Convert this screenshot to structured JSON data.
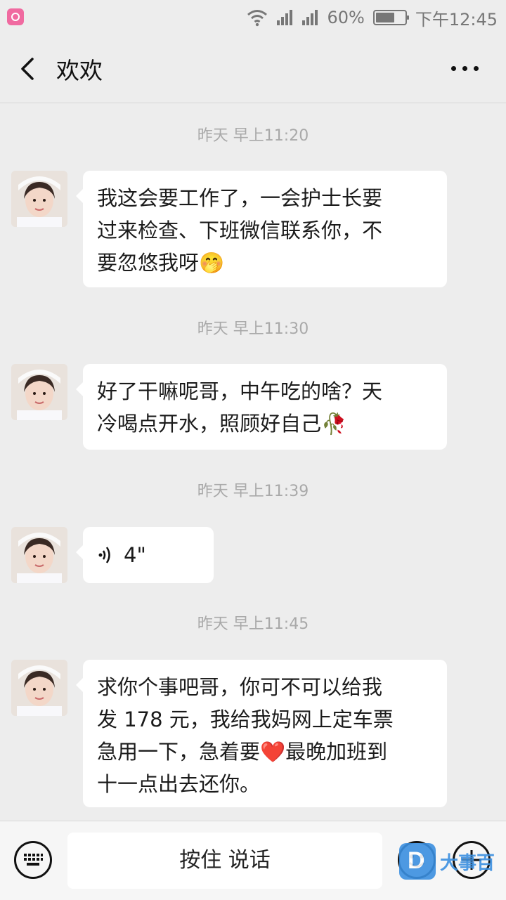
{
  "status_bar": {
    "battery_percent": "60%",
    "time": "下午12:45"
  },
  "header": {
    "title": "欢欢"
  },
  "messages": [
    {
      "timestamp": "昨天 早上11:20",
      "type": "text",
      "text": "我这会要工作了，一会护士长要\n过来检查、下班微信联系你，不\n要忽悠我呀🤭"
    },
    {
      "timestamp": "昨天 早上11:30",
      "type": "text",
      "text": "好了干嘛呢哥，中午吃的啥？天\n冷喝点开水，照顾好自己🥀"
    },
    {
      "timestamp": "昨天 早上11:39",
      "type": "voice",
      "duration": "4\""
    },
    {
      "timestamp": "昨天 早上11:45",
      "type": "text",
      "text": "求你个事吧哥，你可不可以给我\n发 178 元，我给我妈网上定车票\n急用一下，急着要❤️最晚加班到\n十一点出去还你。"
    }
  ],
  "input_bar": {
    "hold_to_talk_label": "按住 说话"
  },
  "watermark": {
    "text": "大事百"
  }
}
